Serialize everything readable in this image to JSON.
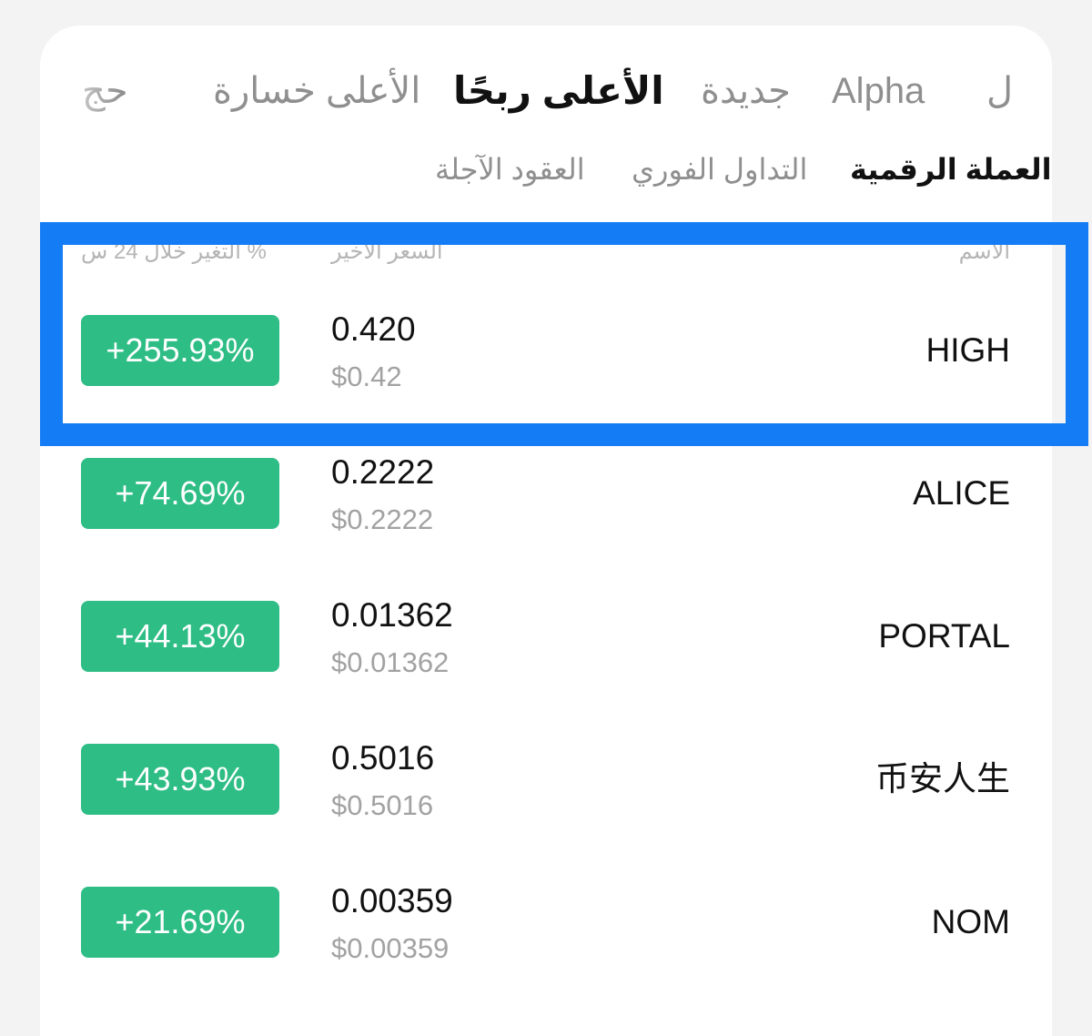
{
  "tabs": [
    {
      "label": "حج",
      "active": false
    },
    {
      "label": "الأعلى خسارة",
      "active": false
    },
    {
      "label": "الأعلى ربحًا",
      "active": true
    },
    {
      "label": "جديدة",
      "active": false
    },
    {
      "label": "Alpha",
      "active": false
    },
    {
      "label": "ل",
      "active": false
    }
  ],
  "subtabs": [
    {
      "label": "العقود الآجلة",
      "active": false
    },
    {
      "label": "التداول الفوري",
      "active": false
    },
    {
      "label": "العملة الرقمية",
      "active": true
    }
  ],
  "columns": {
    "change": "التغير خلال 24 س %",
    "last_price": "السعر الأخير",
    "name": "الاسم"
  },
  "rows": [
    {
      "name": "HIGH",
      "price": "0.420",
      "price_usd": "$0.42",
      "change": "+255.93%"
    },
    {
      "name": "ALICE",
      "price": "0.2222",
      "price_usd": "$0.2222",
      "change": "+74.69%"
    },
    {
      "name": "PORTAL",
      "price": "0.01362",
      "price_usd": "$0.01362",
      "change": "+44.13%"
    },
    {
      "name": "币安人生",
      "price": "0.5016",
      "price_usd": "$0.5016",
      "change": "+43.93%"
    },
    {
      "name": "NOM",
      "price": "0.00359",
      "price_usd": "$0.00359",
      "change": "+21.69%"
    }
  ],
  "colors": {
    "positive": "#2ebd85",
    "highlight": "#147df5"
  }
}
